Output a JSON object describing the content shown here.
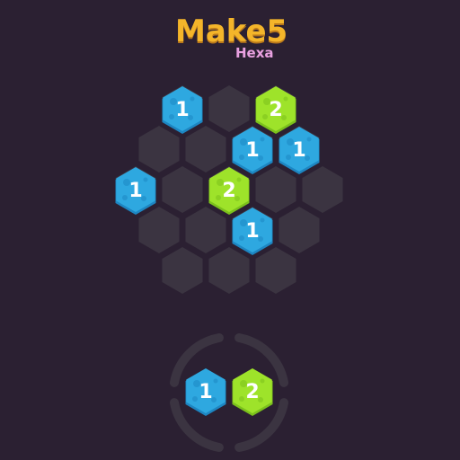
{
  "title": {
    "main": "Make5",
    "sub": "Hexa"
  },
  "colors": {
    "background": "#2b2032",
    "empty_cell": "#3b3441",
    "tile_1": "#2ea8e0",
    "tile_1_shade": "#1d86c2",
    "tile_2": "#9ee32a",
    "tile_2_shade": "#7bc11c",
    "tray_ring": "#3b3441"
  },
  "board": {
    "tiles": [
      {
        "cell": "r0c0",
        "value": "1",
        "color": "blue"
      },
      {
        "cell": "r0c2",
        "value": "2",
        "color": "green"
      },
      {
        "cell": "r1c2",
        "value": "1",
        "color": "blue"
      },
      {
        "cell": "r1c3",
        "value": "1",
        "color": "blue"
      },
      {
        "cell": "r2c0",
        "value": "1",
        "color": "blue"
      },
      {
        "cell": "r2c2",
        "value": "2",
        "color": "green"
      },
      {
        "cell": "r3c2",
        "value": "1",
        "color": "blue"
      }
    ]
  },
  "tray": {
    "piece": [
      {
        "value": "1",
        "color": "blue"
      },
      {
        "value": "2",
        "color": "green"
      }
    ]
  }
}
